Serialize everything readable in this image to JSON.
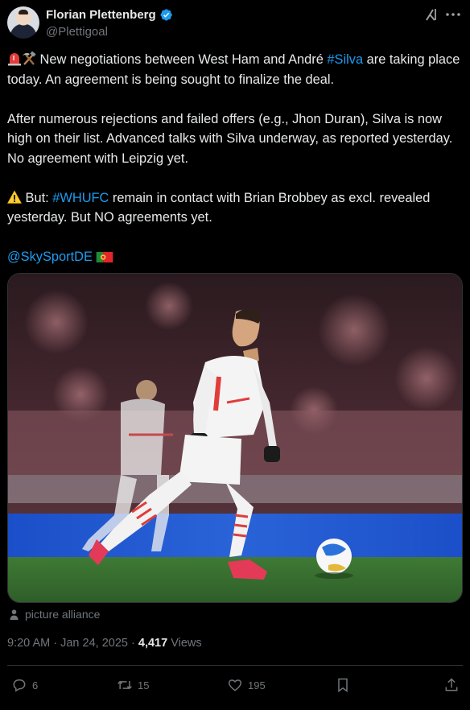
{
  "author": {
    "name": "Florian Plettenberg",
    "handle": "@Plettigoal",
    "verified": true
  },
  "icons": {
    "verified": "verified-badge-icon",
    "grok": "grok-icon",
    "more": "more-icon",
    "siren": "rotating-light-emoji",
    "hammer_pick": "hammer-and-pick-emoji",
    "warning": "warning-emoji",
    "flag": "portugal-flag-emoji",
    "attribution": "person-icon",
    "reply": "reply-icon",
    "retweet": "retweet-icon",
    "like": "heart-icon",
    "bookmark": "bookmark-icon",
    "share": "share-icon"
  },
  "tweet": {
    "p1_text_a": " New negotiations between West Ham and André ",
    "p1_hashtag": "#Silva",
    "p1_text_b": " are taking place today. An agreement is being sought to finalize the deal.",
    "p2_text": "After numerous rejections and failed offers (e.g., Jhon Duran), Silva is now high on their list. Advanced talks with Silva underway, as reported yesterday. No agreement with Leipzig yet.",
    "p3_text_a": " But: ",
    "p3_hashtag": "#WHUFC",
    "p3_text_b": " remain in contact with Brian Brobbey as excl. revealed yesterday. But NO agreements yet.",
    "mention": "@SkySportDE"
  },
  "media": {
    "attribution": "picture alliance"
  },
  "meta": {
    "time": "9:20 AM",
    "separator": "·",
    "date": "Jan 24, 2025",
    "views_count": "4,417",
    "views_label": "Views"
  },
  "actions": {
    "replies": "6",
    "reposts": "15",
    "likes": "195"
  },
  "colors": {
    "background": "#000000",
    "text": "#e7e9ea",
    "muted": "#71767b",
    "link": "#1d9bf0",
    "divider": "#2f3336",
    "verified": "#1d9bf0"
  }
}
